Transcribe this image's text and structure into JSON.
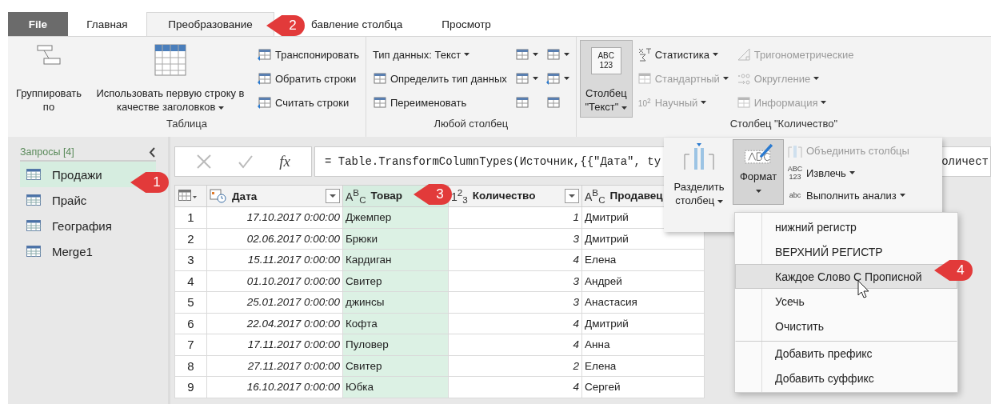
{
  "tabs": [
    {
      "label": "File",
      "kind": "file",
      "selected": false
    },
    {
      "label": "Главная",
      "kind": "tab",
      "selected": false
    },
    {
      "label": "Преобразование",
      "kind": "tab",
      "selected": true
    },
    {
      "label": "бавление столбца",
      "kind": "tab",
      "selected": false
    },
    {
      "label": "Просмотр",
      "kind": "tab",
      "selected": false
    }
  ],
  "ribbon": {
    "groups": [
      {
        "label": "Таблица",
        "large": [
          {
            "label": "Группировать по",
            "dropdown": false,
            "pressed": false
          },
          {
            "label": "Использовать первую строку в качестве заголовков",
            "dropdown": true,
            "pressed": false
          }
        ],
        "columns": [
          [
            {
              "label": "Транспонировать",
              "dropdown": false,
              "disabled": false
            },
            {
              "label": "Обратить строки",
              "dropdown": false,
              "disabled": false
            },
            {
              "label": "Считать строки",
              "dropdown": false,
              "disabled": false
            }
          ]
        ]
      },
      {
        "label": "Любой столбец",
        "columns": [
          [
            {
              "label": "Тип данных: Текст",
              "dropdown": true,
              "disabled": false
            },
            {
              "label": "Определить тип данных",
              "dropdown": false,
              "disabled": false
            },
            {
              "label": "Переименовать",
              "dropdown": false,
              "disabled": false
            }
          ],
          [
            {
              "dropdown": true,
              "disabled": false
            },
            {
              "dropdown": true,
              "disabled": false
            },
            {
              "dropdown": false,
              "disabled": false
            }
          ],
          [
            {
              "dropdown": true,
              "disabled": false
            },
            {
              "dropdown": true,
              "disabled": false
            },
            {
              "dropdown": false,
              "disabled": false
            }
          ]
        ]
      },
      {
        "label": "Столбец \"Количество\"",
        "large": [
          {
            "label": "Столбец \"Текст\"",
            "icon_text": "ABC 123",
            "dropdown": true,
            "pressed": true
          }
        ],
        "columns": [
          [
            {
              "label": "Статистика",
              "dropdown": true,
              "disabled": false
            },
            {
              "label": "Стандартный",
              "dropdown": true,
              "disabled": true
            },
            {
              "label": "Научный",
              "icon_text": "10$^{2}$",
              "dropdown": true,
              "disabled": true
            }
          ],
          [
            {
              "label": "Тригонометрические",
              "dropdown": false,
              "disabled": true
            },
            {
              "label": "Округление",
              "dropdown": true,
              "disabled": true
            },
            {
              "label": "Информация",
              "dropdown": true,
              "disabled": true
            }
          ]
        ]
      }
    ]
  },
  "sidebar": {
    "title": "Запросы [4]",
    "items": [
      {
        "label": "Продажи",
        "selected": true
      },
      {
        "label": "Прайс",
        "selected": false
      },
      {
        "label": "География",
        "selected": false
      },
      {
        "label": "Merge1",
        "selected": false
      }
    ]
  },
  "formula_bar": {
    "fx": "fx",
    "formula": "= Table.TransformColumnTypes(Источник,{{\"Дата\", ty",
    "formula_tail": "оличест"
  },
  "table": {
    "columns": [
      {
        "label": "Дата",
        "kind": "date",
        "filter": true,
        "selected": false
      },
      {
        "label": "Товар",
        "kind": "text",
        "type_label": "A$^{B}$$_{C}$",
        "filter": false,
        "selected": true
      },
      {
        "label": "Количество",
        "kind": "number",
        "type_label": "1$^{2}$$_{3}$",
        "filter": true,
        "selected": false
      },
      {
        "label": "Продавец",
        "kind": "text",
        "type_label": "A$^{B}$$_{C}$",
        "selected": false
      }
    ],
    "rows": [
      {
        "number": "1",
        "cells": [
          "17.10.2017 0:00:00",
          "Джемпер",
          "1",
          "Дмитрий"
        ]
      },
      {
        "number": "2",
        "cells": [
          "02.06.2017 0:00:00",
          "Брюки",
          "3",
          "Дмитрий"
        ]
      },
      {
        "number": "3",
        "cells": [
          "15.11.2017 0:00:00",
          "Кардиган",
          "4",
          "Елена"
        ]
      },
      {
        "number": "4",
        "cells": [
          "01.10.2017 0:00:00",
          "Свитер",
          "3",
          "Андрей"
        ]
      },
      {
        "number": "5",
        "cells": [
          "25.01.2017 0:00:00",
          "джинсы",
          "3",
          "Анастасия"
        ]
      },
      {
        "number": "6",
        "cells": [
          "22.04.2017 0:00:00",
          "Кофта",
          "4",
          "Дмитрий"
        ]
      },
      {
        "number": "7",
        "cells": [
          "17.11.2017 0:00:00",
          "Пуловер",
          "4",
          "Анна"
        ]
      },
      {
        "number": "8",
        "cells": [
          "27.11.2017 0:00:00",
          "Свитер",
          "2",
          "Елена"
        ]
      },
      {
        "number": "9",
        "cells": [
          "16.10.2017 0:00:00",
          "Юбка",
          "4",
          "Сергей"
        ]
      }
    ]
  },
  "text_panel": {
    "large": [
      {
        "label": "Разделить столбец",
        "dropdown": true,
        "pressed": false
      },
      {
        "label": "Формат",
        "dropdown": true,
        "pressed": true
      }
    ],
    "items": [
      {
        "label": "Объединить столбцы",
        "dropdown": false,
        "disabled": true
      },
      {
        "label": "Извлечь",
        "icon_text": "ABC 123",
        "dropdown": true,
        "disabled": false
      },
      {
        "label": "Выполнить анализ",
        "icon_text": "abc",
        "dropdown": true,
        "disabled": false
      }
    ]
  },
  "format_menu": [
    {
      "label": "нижний регистр",
      "selected": false,
      "separator_before": false
    },
    {
      "label": "ВЕРХНИЙ РЕГИСТР",
      "selected": false,
      "separator_before": false
    },
    {
      "label": "Каждое Слово С Прописной",
      "selected": true,
      "separator_before": false
    },
    {
      "label": "Усечь",
      "selected": false,
      "separator_before": false
    },
    {
      "label": "Очистить",
      "selected": false,
      "separator_before": false
    },
    {
      "label": "Добавить префикс",
      "selected": false,
      "separator_before": true
    },
    {
      "label": "Добавить суффикс",
      "selected": false,
      "separator_before": false
    }
  ],
  "callouts": [
    "1",
    "2",
    "3",
    "4"
  ]
}
